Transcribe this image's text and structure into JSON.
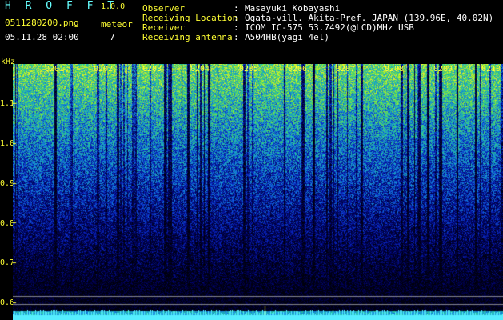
{
  "header": {
    "brand": "H R O F F T",
    "version": "1.0.0",
    "filename": "0511280200.png",
    "timestamp": "05.11.28 02:00",
    "meteor_label": "meteor",
    "meteor_count": "7",
    "fields": [
      {
        "label": "Observer",
        "value": "Masayuki Kobayashi"
      },
      {
        "label": "Receiving Location",
        "value": "Ogata-vill. Akita-Pref. JAPAN (139.96E, 40.02N)"
      },
      {
        "label": "Receiver",
        "value": "ICOM IC-575 53.7492(@LCD)MHz USB"
      },
      {
        "label": "Receiving antenna",
        "value": "A504HB(yagi 4el)"
      }
    ],
    "colon": ":"
  },
  "axis": {
    "unit": "kHz",
    "y_ticks": [
      "1.1",
      "1.0",
      "0.9",
      "0.8",
      "0.7",
      "0.6"
    ],
    "x_ticks": [
      "0201",
      "0202",
      "0203",
      "0204",
      "0205",
      "0206",
      "0207",
      "0208",
      "0209",
      "0210"
    ]
  },
  "colors": {
    "label_yellow": "#ffff33",
    "value_white": "#ffffff",
    "meteor_cyan": "#66ffff",
    "background": "#000000"
  }
}
